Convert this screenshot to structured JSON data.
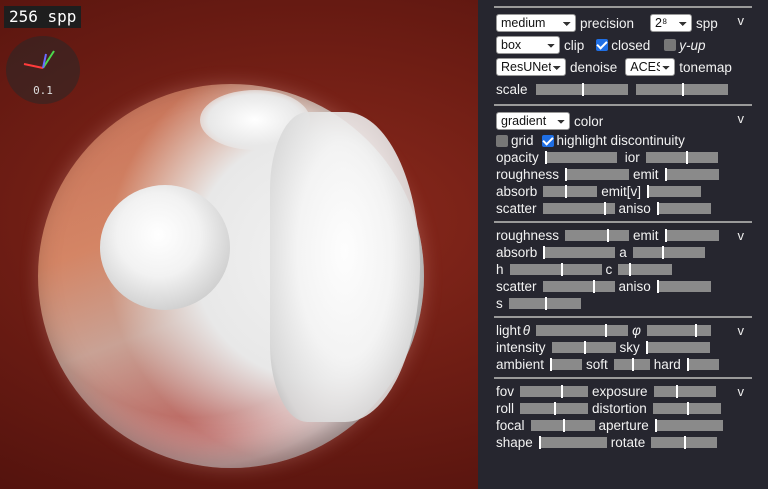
{
  "viewport": {
    "spp_label": "256 spp",
    "gizmo_scale": "0.1"
  },
  "render": {
    "precision_value": "medium",
    "precision_label": "precision",
    "spp_value": "2⁸",
    "spp_label": "spp",
    "clip_value": "box",
    "clip_label": "clip",
    "closed_label": "closed",
    "closed_checked": true,
    "yup_label": "y-up",
    "yup_checked": false,
    "denoise_value": "ResUNet",
    "denoise_label": "denoise",
    "tonemap_value": "ACES",
    "tonemap_label": "tonemap",
    "scale_label": "scale",
    "scale_a": 0.5,
    "scale_b": 0.5
  },
  "material": {
    "color_value": "gradient",
    "color_label": "color",
    "grid_label": "grid",
    "grid_checked": false,
    "highlight_label": "highlight discontinuity",
    "highlight_checked": true,
    "opacity_label": "opacity",
    "opacity": 0.0,
    "ior_label": "ior",
    "ior": 0.55,
    "roughness_label": "roughness",
    "roughness": 0.0,
    "emit_label": "emit",
    "emit": 0.0,
    "absorb_label": "absorb",
    "absorb": 0.4,
    "emitv_label": "emit[v]",
    "emitv": 0.0,
    "scatter_label": "scatter",
    "scatter": 0.85,
    "aniso_label": "aniso",
    "aniso": 0.0
  },
  "medium": {
    "roughness_label": "roughness",
    "roughness": 0.65,
    "emit_label": "emit",
    "emit": 0.0,
    "absorb_label": "absorb",
    "absorb": 0.0,
    "a_label": "a",
    "a": 0.4,
    "h_label": "h",
    "h": 0.55,
    "c_label": "c",
    "c": 0.2,
    "scatter_label": "scatter",
    "scatter": 0.7,
    "aniso_label": "aniso",
    "aniso": 0.0,
    "s_label": "s",
    "s": 0.5
  },
  "lighting": {
    "light_label": "light",
    "theta_symbol": "θ",
    "theta": 0.75,
    "phi_symbol": "φ",
    "phi": 0.75,
    "intensity_label": "intensity",
    "intensity": 0.5,
    "sky_label": "sky",
    "sky": 0.0,
    "ambient_label": "ambient",
    "ambient": 0.0,
    "soft_label": "soft",
    "soft": 0.5,
    "hard_label": "hard",
    "hard": 0.0
  },
  "camera": {
    "fov_label": "fov",
    "fov": 0.6,
    "exposure_label": "exposure",
    "exposure": 0.35,
    "roll_label": "roll",
    "roll": 0.5,
    "distortion_label": "distortion",
    "distortion": 0.5,
    "focal_label": "focal",
    "focal": 0.5,
    "aperture_label": "aperture",
    "aperture": 0.0,
    "shape_label": "shape",
    "shape": 0.0,
    "rotate_label": "rotate",
    "rotate": 0.5
  },
  "chevron": "v"
}
